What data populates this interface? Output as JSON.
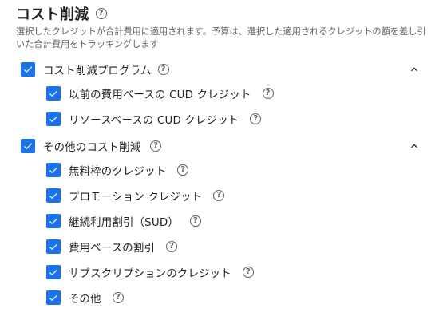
{
  "header": {
    "title": "コスト削減",
    "description": "選択したクレジットが合計費用に適用されます。予算は、選択した適用されるクレジットの額を差し引いた合計費用をトラッキングします"
  },
  "groups": [
    {
      "label": "コスト削減プログラム",
      "checked": true,
      "expanded": true,
      "items": [
        {
          "label": "以前の費用ベースの CUD クレジット",
          "checked": true
        },
        {
          "label": "リソースベースの CUD クレジット",
          "checked": true
        }
      ]
    },
    {
      "label": "その他のコスト削減",
      "checked": true,
      "expanded": true,
      "items": [
        {
          "label": "無料枠のクレジット",
          "checked": true
        },
        {
          "label": "プロモーション クレジット",
          "checked": true
        },
        {
          "label": "継続利用割引（SUD）",
          "checked": true
        },
        {
          "label": "費用ベースの割引",
          "checked": true
        },
        {
          "label": "サブスクリプションのクレジット",
          "checked": true
        },
        {
          "label": "その他",
          "checked": true
        }
      ]
    }
  ],
  "colors": {
    "accent": "#1a73e8",
    "text": "#202124",
    "muted": "#5f6368"
  },
  "icons": {
    "help": "help-circle-icon",
    "check": "checkmark-icon",
    "collapse": "chevron-up-icon"
  }
}
